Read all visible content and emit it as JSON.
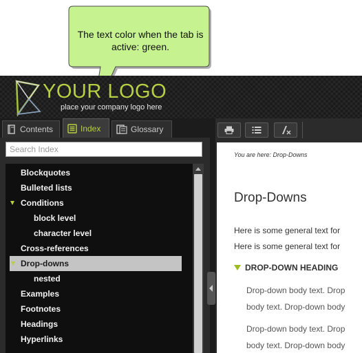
{
  "logo": {
    "text": "YOUR LOGO",
    "tagline": "place your company logo here",
    "accent": "#b7cf43"
  },
  "tabs": [
    {
      "label": "Contents",
      "icon": "book-icon",
      "active": false
    },
    {
      "label": "Index",
      "icon": "list-icon",
      "active": true
    },
    {
      "label": "Glossary",
      "icon": "glossary-book-icon",
      "active": false
    }
  ],
  "search": {
    "placeholder": "Search Index",
    "value": ""
  },
  "index": {
    "items": [
      {
        "label": "Blockquotes",
        "level": 0,
        "expandable": false,
        "selected": false
      },
      {
        "label": "Bulleted lists",
        "level": 0,
        "expandable": false,
        "selected": false
      },
      {
        "label": "Conditions",
        "level": 0,
        "expandable": true,
        "selected": false
      },
      {
        "label": "block level",
        "level": 1,
        "expandable": false,
        "selected": false
      },
      {
        "label": "character level",
        "level": 1,
        "expandable": false,
        "selected": false
      },
      {
        "label": "Cross-references",
        "level": 0,
        "expandable": false,
        "selected": false
      },
      {
        "label": "Drop-downs",
        "level": 0,
        "expandable": true,
        "selected": true
      },
      {
        "label": "nested",
        "level": 1,
        "expandable": false,
        "selected": false
      },
      {
        "label": "Examples",
        "level": 0,
        "expandable": false,
        "selected": false
      },
      {
        "label": "Footnotes",
        "level": 0,
        "expandable": false,
        "selected": false
      },
      {
        "label": "Headings",
        "level": 0,
        "expandable": false,
        "selected": false
      },
      {
        "label": "Hyperlinks",
        "level": 0,
        "expandable": false,
        "selected": false
      }
    ]
  },
  "toolbar": {
    "buttons": [
      "print-icon",
      "toc-list-icon",
      "remove-highlight-icon"
    ]
  },
  "topic": {
    "breadcrumb": "You are here: Drop-Downs",
    "title": "Drop-Downs",
    "para1": "Here is some general text for",
    "para2": "Here is some general text for",
    "dropdown_heading": "DROP-DOWN HEADING",
    "dd_line1": "Drop-down body text. Drop",
    "dd_line2": "body text. Drop-down body",
    "dd_line3": "Drop-down body text. Drop",
    "dd_line4": "body text. Drop-down body"
  },
  "callout": {
    "text": "The text color when the tab is active: green.",
    "fill": "#c6f28f"
  },
  "colors": {
    "accent_green": "#b7cf43",
    "chrome_dark": "#1c1c1c",
    "selected_row": "#c4c4c4"
  }
}
